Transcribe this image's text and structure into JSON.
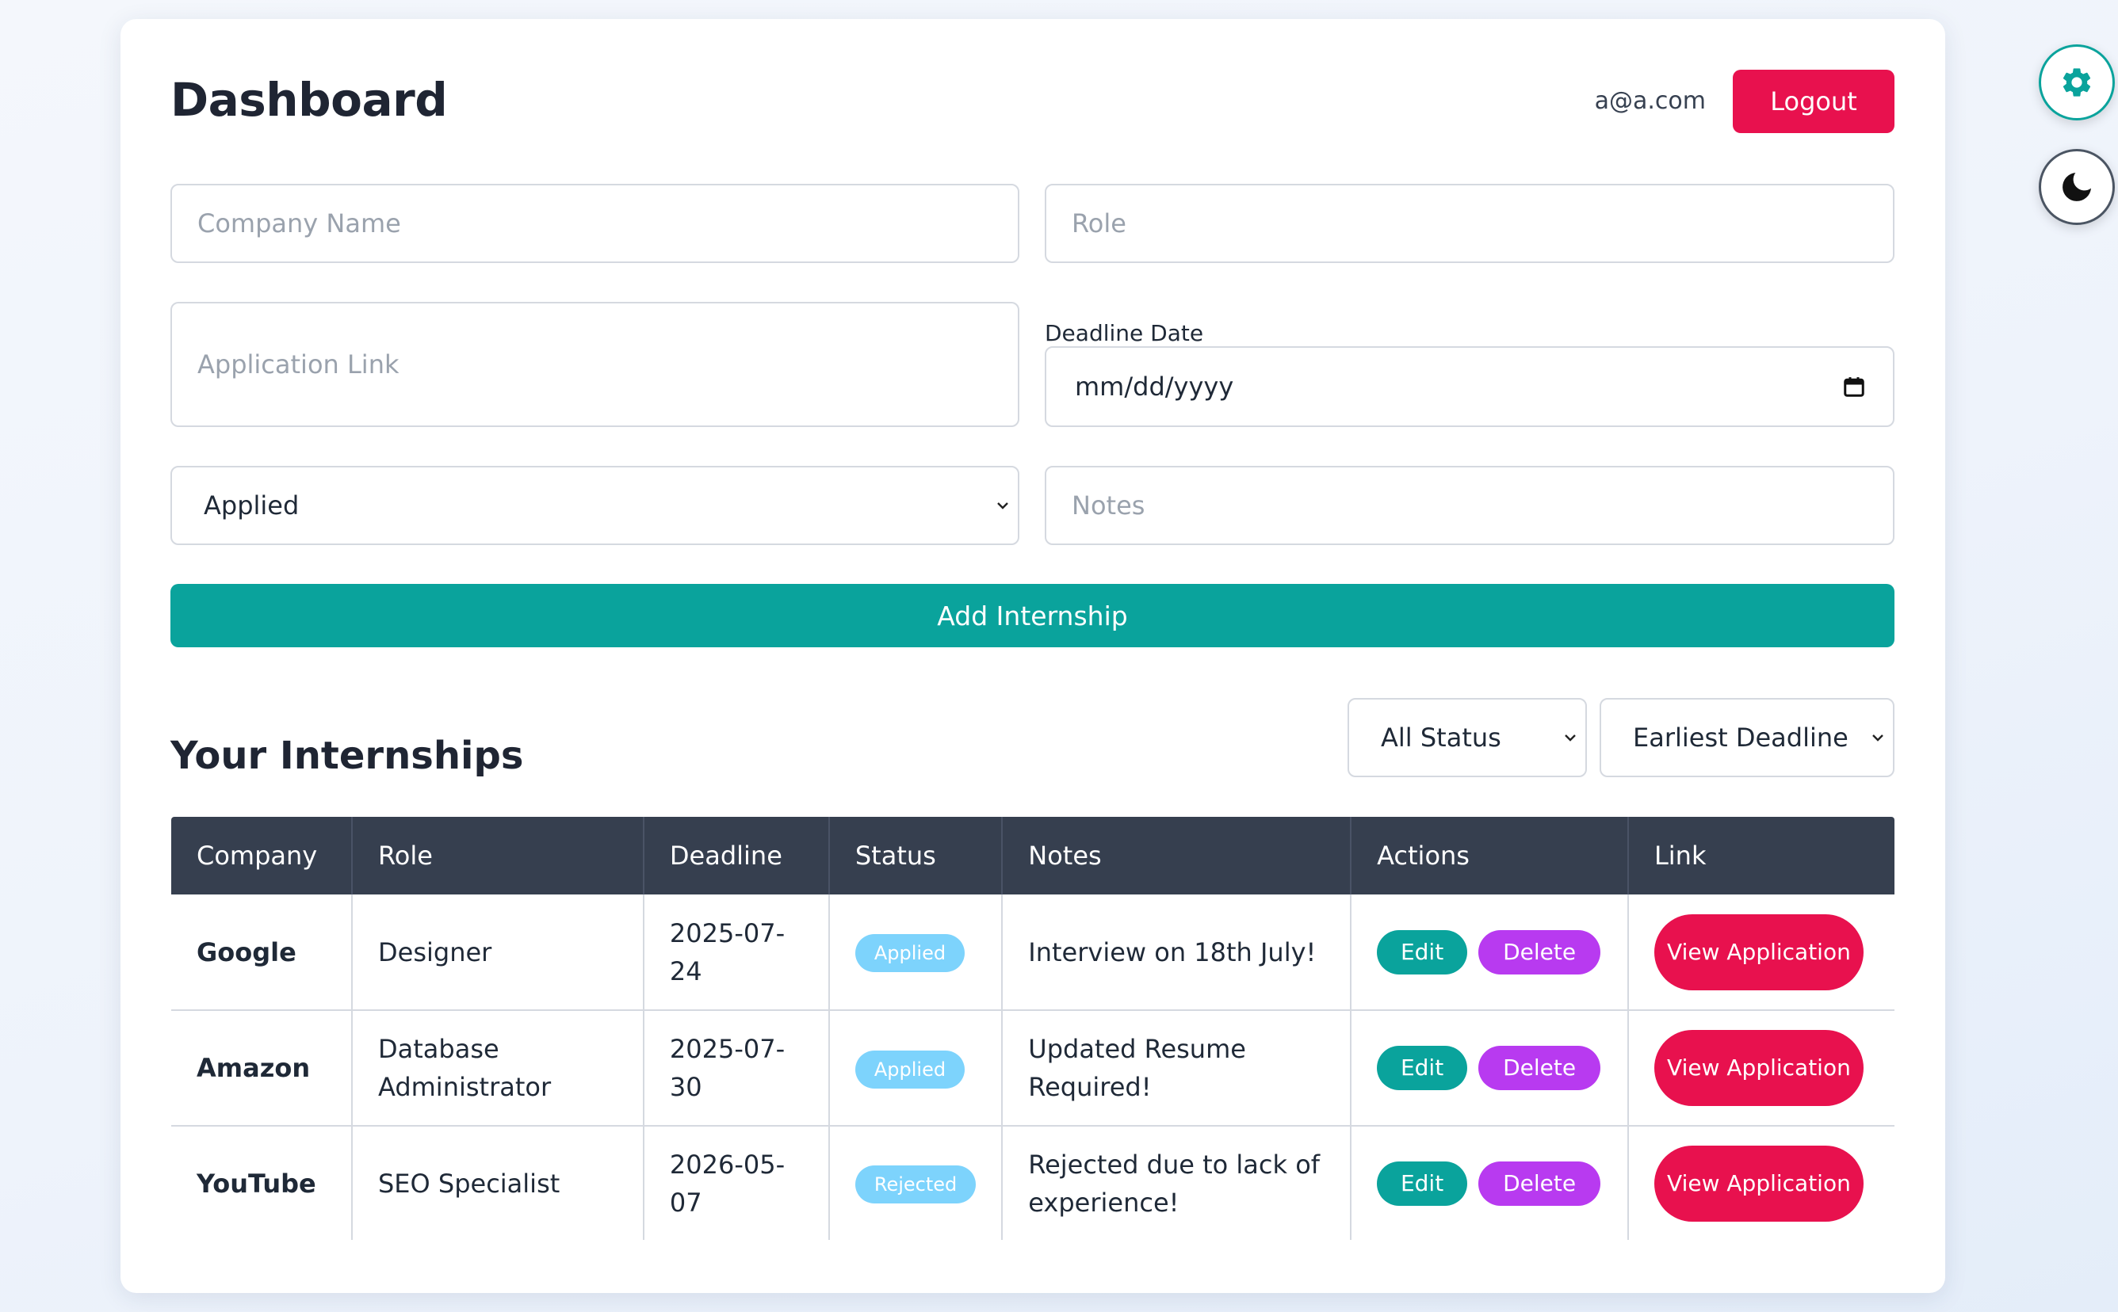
{
  "header": {
    "title": "Dashboard",
    "user_email": "a@a.com",
    "logout_label": "Logout"
  },
  "form": {
    "company_placeholder": "Company Name",
    "role_placeholder": "Role",
    "link_placeholder": "Application Link",
    "deadline_label": "Deadline Date",
    "deadline_value": "mm/dd/yyyy",
    "status_value": "Applied",
    "notes_placeholder": "Notes",
    "submit_label": "Add Internship"
  },
  "list": {
    "title": "Your Internships",
    "status_filter": "All Status",
    "sort_value": "Earliest Deadline",
    "columns": [
      "Company",
      "Role",
      "Deadline",
      "Status",
      "Notes",
      "Actions",
      "Link"
    ],
    "rows": [
      {
        "company": "Google",
        "role": "Designer",
        "deadline": "2025-07-24",
        "status": "Applied",
        "notes": "Interview on 18th July!"
      },
      {
        "company": "Amazon",
        "role": "Database Administrator",
        "deadline": "2025-07-30",
        "status": "Applied",
        "notes": "Updated Resume Required!"
      },
      {
        "company": "YouTube",
        "role": "SEO Specialist",
        "deadline": "2026-05-07",
        "status": "Rejected",
        "notes": "Rejected due to lack of experience!"
      }
    ],
    "edit_label": "Edit",
    "delete_label": "Delete",
    "view_label": "View Application"
  },
  "side_buttons": {
    "settings_icon": "gear-icon",
    "theme_icon": "moon-icon"
  },
  "colors": {
    "primary": "#0aa39c",
    "danger": "#e8114e",
    "delete": "#b83af0",
    "badge": "#7dd3fc",
    "header_bg": "#363f4f"
  }
}
